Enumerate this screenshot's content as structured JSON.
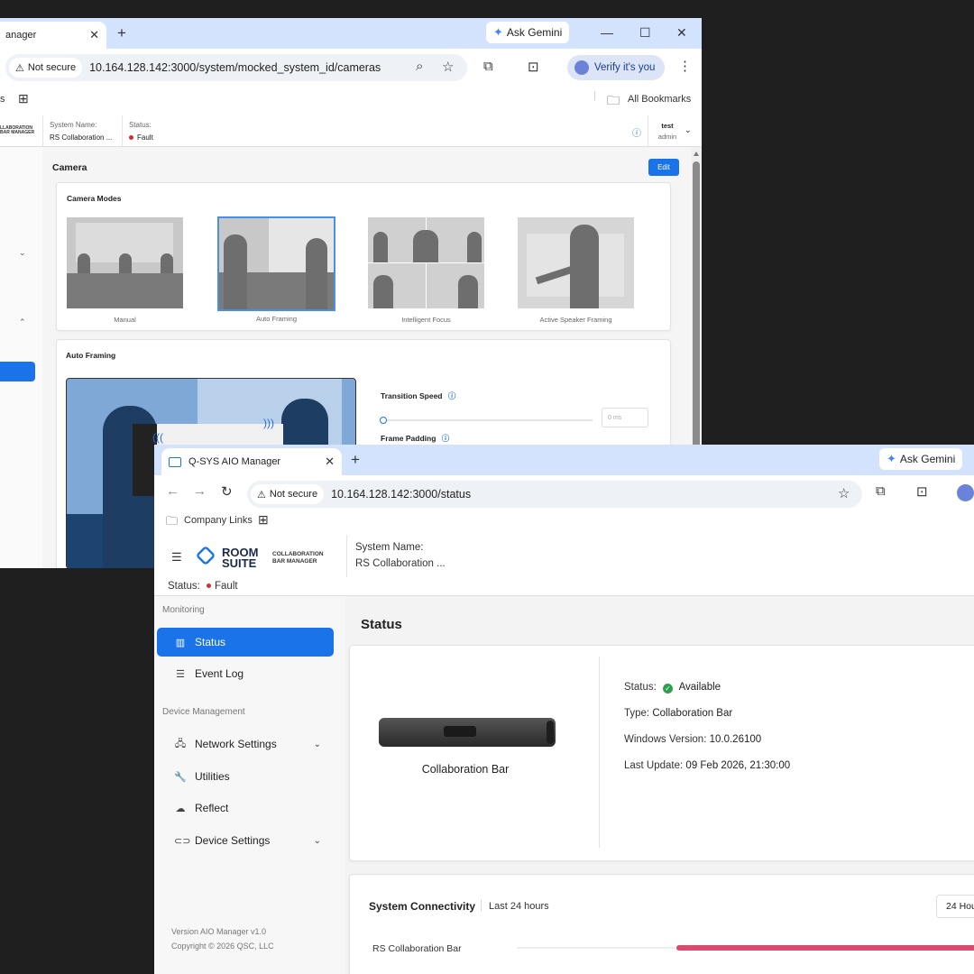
{
  "back_window": {
    "tab_title": "anager",
    "gemini_label": "Ask Gemini",
    "not_secure": "Not secure",
    "url": "10.164.128.142:3000/system/mocked_system_id/cameras",
    "verify_label": "Verify it's you",
    "bookmarks_label": "All Bookmarks",
    "bookmark_left": "s",
    "header": {
      "logo_line1": "LLABORATION",
      "logo_line2": "BAR MANAGER",
      "system_name_label": "System Name:",
      "system_name_value": "RS Collaboration ...",
      "status_label": "Status:",
      "status_value": "Fault",
      "user_name": "test",
      "user_role": "admin"
    },
    "page_title": "Camera",
    "edit_label": "Edit",
    "camera_modes_title": "Camera Modes",
    "modes": [
      "Manual",
      "Auto Framing",
      "Intelligent Focus",
      "Active Speaker Framing"
    ],
    "selected_mode": "Auto Framing",
    "auto_framing_title": "Auto Framing",
    "transition_speed_label": "Transition Speed",
    "transition_speed_value": "0 ms",
    "frame_padding_label": "Frame Padding"
  },
  "front_window": {
    "tab_title": "Q-SYS AIO Manager",
    "gemini_label": "Ask Gemini",
    "not_secure": "Not secure",
    "url": "10.164.128.142:3000/status",
    "bookmark_company": "Company Links",
    "logo_room": "ROOM",
    "logo_suite": "SUITE",
    "logo_sub1": "COLLABORATION",
    "logo_sub2": "BAR MANAGER",
    "system_name_label": "System Name:",
    "system_name_value": "RS Collaboration ...",
    "status_label": "Status:",
    "status_value": "Fault",
    "sidebar": {
      "monitoring_label": "Monitoring",
      "items_monitoring": [
        {
          "label": "Status",
          "icon": "chart-icon",
          "active": true
        },
        {
          "label": "Event Log",
          "icon": "list-icon",
          "active": false
        }
      ],
      "device_mgmt_label": "Device Management",
      "items_device": [
        {
          "label": "Network Settings",
          "icon": "network-icon",
          "expandable": true
        },
        {
          "label": "Utilities",
          "icon": "wrench-icon",
          "expandable": false
        },
        {
          "label": "Reflect",
          "icon": "cloud-icon",
          "expandable": false
        },
        {
          "label": "Device Settings",
          "icon": "link-icon",
          "expandable": true
        }
      ],
      "version": "Version AIO Manager v1.0",
      "copyright": "Copyright © 2026 QSC, LLC"
    },
    "page_title": "Status",
    "device_name": "Collaboration Bar",
    "details": {
      "status_label": "Status:",
      "status_value": "Available",
      "type_label": "Type:",
      "type_value": "Collaboration Bar",
      "windows_label": "Windows Version:",
      "windows_value": "10.0.26100",
      "update_label": "Last Update:",
      "update_value": "09 Feb 2026, 21:30:00"
    },
    "connectivity": {
      "title": "System Connectivity",
      "range": "Last 24 hours",
      "range_button": "24 Hou",
      "row_label": "RS Collaboration Bar"
    }
  },
  "colors": {
    "accent": "#1a73e8",
    "fault": "#d32f2f",
    "available": "#2e9e4f",
    "connectivity_bar": "#d94a6f",
    "tabstrip": "#d3e3fd"
  }
}
